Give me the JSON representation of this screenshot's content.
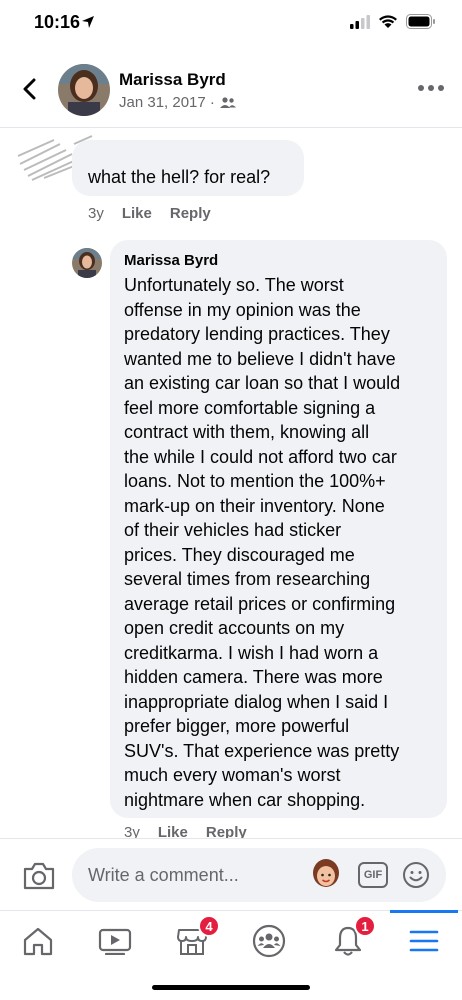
{
  "status_bar": {
    "time": "10:16"
  },
  "header": {
    "author_name": "Marissa Byrd",
    "date": "Jan 31, 2017 ·",
    "privacy_icon": "friends-icon"
  },
  "first_comment": {
    "text": "what the hell? for real?",
    "age": "3y",
    "like_label": "Like",
    "reply_label": "Reply"
  },
  "reply_comment": {
    "author_name": "Marissa Byrd",
    "text": "Unfortunately so. The worst\noffense in my opinion was the\npredatory lending practices. They\nwanted me to believe I didn't have\nan existing car loan so that I would\nfeel more comfortable signing a\ncontract with them, knowing all\nthe while I could not afford two car\nloans. Not to mention the 100%+\nmark-up on their inventory. None\nof their vehicles had sticker\nprices. They discouraged me\nseveral times from researching\naverage retail prices or confirming\nopen credit accounts on my\ncreditkarma. I wish I had worn a\nhidden camera. There was more\ninappropriate dialog when I said I\nprefer bigger, more powerful\nSUV's. That experience was pretty\nmuch every woman's worst\nnightmare when car shopping.",
    "age": "3y",
    "like_label": "Like",
    "reply_label": "Reply"
  },
  "composer": {
    "placeholder": "Write a comment...",
    "gif_label": "GIF"
  },
  "bottom_nav": {
    "items": [
      {
        "icon": "home-icon"
      },
      {
        "icon": "video-icon"
      },
      {
        "icon": "marketplace-icon",
        "badge": "4"
      },
      {
        "icon": "groups-icon"
      },
      {
        "icon": "bell-icon",
        "badge": "1"
      },
      {
        "icon": "menu-icon",
        "active": true
      }
    ]
  },
  "colors": {
    "accent": "#1877f2",
    "bubble": "#f0f2f5",
    "secondary_text": "#65676b",
    "badge": "#e41e3f"
  }
}
